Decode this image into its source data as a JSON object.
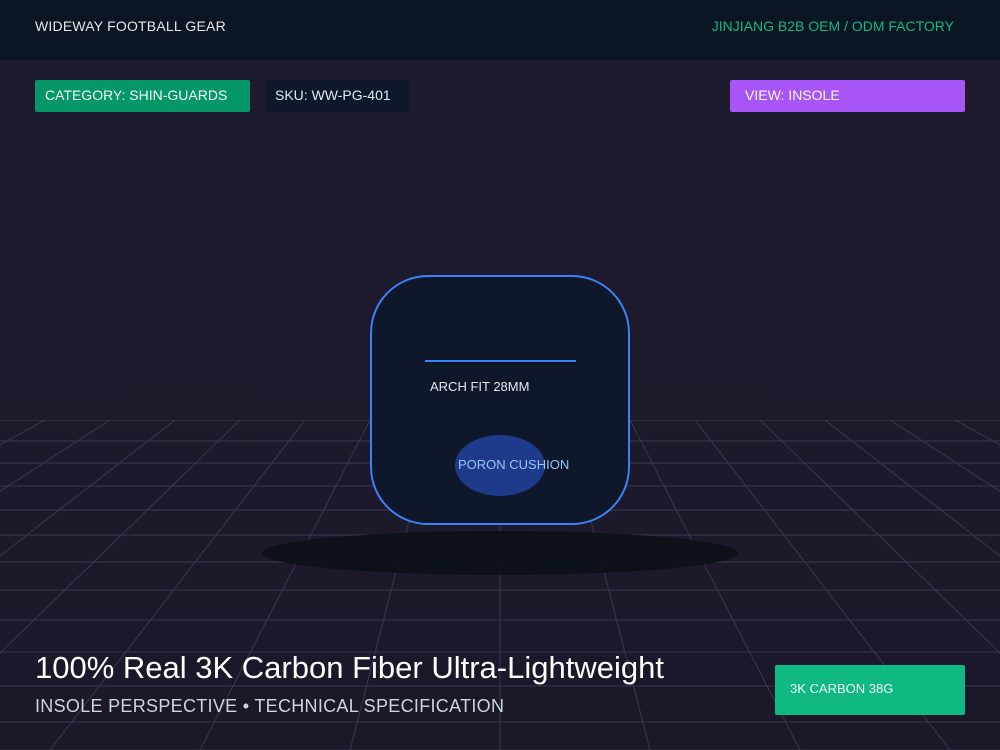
{
  "header": {
    "brand": "WIDEWAY FOOTBALL GEAR",
    "factory": "JINJIANG B2B OEM / ODM FACTORY"
  },
  "chips": {
    "category": "CATEGORY: SHIN-GUARDS",
    "sku": "SKU: WW-PG-401",
    "view": "VIEW: INSOLE"
  },
  "product": {
    "arch_label": "ARCH FIT 28MM",
    "cushion_label": "PORON CUSHION"
  },
  "footer": {
    "title": "100% Real 3K Carbon Fiber Ultra-Lightweight",
    "subtitle": "INSOLE PERSPECTIVE • TECHNICAL SPECIFICATION",
    "weight_badge": "3K CARBON 38G"
  },
  "colors": {
    "accent_green": "#059669",
    "accent_purple": "#a855f7",
    "accent_blue": "#3b82f6",
    "badge_green": "#10b981"
  }
}
